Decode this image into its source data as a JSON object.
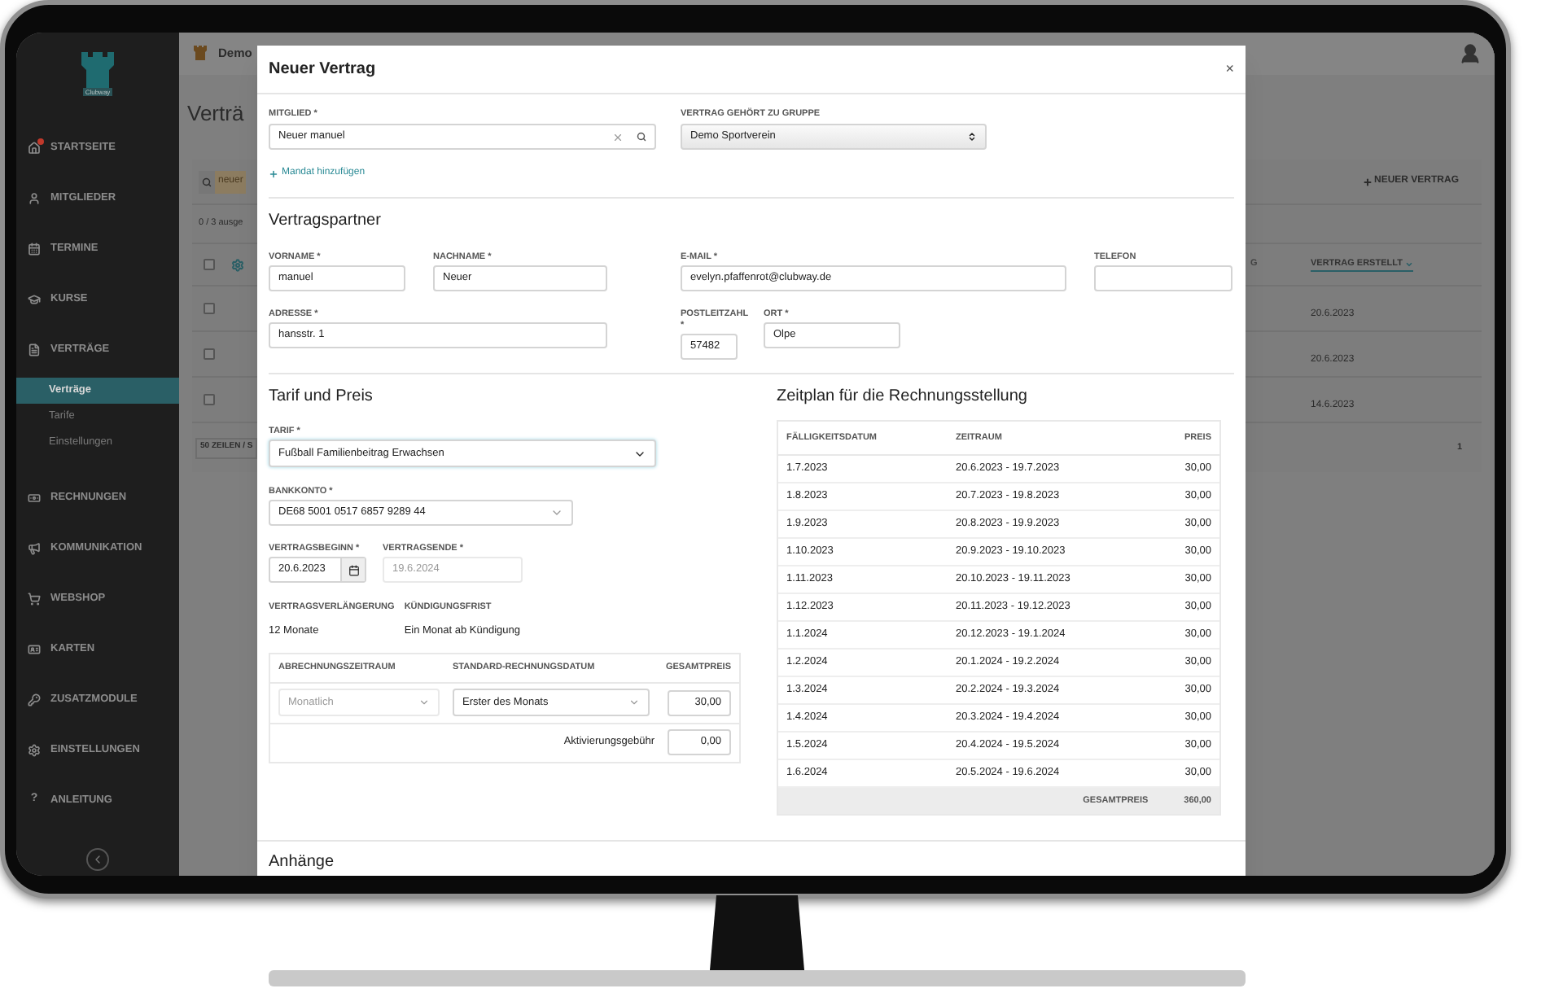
{
  "sidebar": {
    "logo_text": "Clubway",
    "items": [
      {
        "label": "STARTSEITE",
        "selected": false,
        "notification": true
      },
      {
        "label": "MITGLIEDER",
        "selected": false,
        "notification": false
      },
      {
        "label": "TERMINE",
        "selected": false,
        "notification": false
      },
      {
        "label": "KURSE",
        "selected": false,
        "notification": false
      },
      {
        "label": "VERTRÄGE",
        "selected": false,
        "notification": false,
        "children": [
          {
            "label": "Verträge",
            "selected": true
          },
          {
            "label": "Tarife",
            "selected": false
          },
          {
            "label": "Einstellungen",
            "selected": false
          }
        ]
      },
      {
        "label": "RECHNUNGEN",
        "selected": false,
        "notification": false
      },
      {
        "label": "KOMMUNIKATION",
        "selected": false,
        "notification": false
      },
      {
        "label": "WEBSHOP",
        "selected": false,
        "notification": false
      },
      {
        "label": "KARTEN",
        "selected": false,
        "notification": false
      },
      {
        "label": "ZUSATZMODULE",
        "selected": false,
        "notification": false
      },
      {
        "label": "EINSTELLUNGEN",
        "selected": false,
        "notification": false
      },
      {
        "label": "ANLEITUNG",
        "selected": false,
        "notification": false,
        "glyph": "?"
      }
    ]
  },
  "background": {
    "header_title": "Demo",
    "page_title": "Verträ",
    "search_value": "neuer",
    "new_button": "NEUER VERTRAG",
    "selection_count": "0 / 3 ausge",
    "header_checked": false,
    "columns": [
      {
        "label": "G",
        "sorted": false
      },
      {
        "label": "VERTRAG ERSTELLT",
        "sorted": true
      }
    ],
    "rows": [
      {
        "checked": false,
        "created": "20.6.2023"
      },
      {
        "checked": false,
        "created": "20.6.2023"
      },
      {
        "checked": false,
        "created": "14.6.2023"
      }
    ],
    "page_size_button": "50 ZEILEN / S",
    "page": "1"
  },
  "dialog": {
    "title": "Neuer Vertrag",
    "close": "×",
    "member": {
      "label": "MITGLIED *",
      "value": "Neuer manuel"
    },
    "group": {
      "label": "VERTRAG GEHÖRT ZU GRUPPE",
      "value": "Demo Sportverein"
    },
    "add_mandate": "Mandat hinzufügen",
    "partner_heading": "Vertragspartner",
    "partner_fields": [
      {
        "label": "VORNAME *",
        "value": "manuel"
      },
      {
        "label": "NACHNAME *",
        "value": "Neuer"
      },
      {
        "label": "E-MAIL *",
        "value": "evelyn.pfaffenrot@clubway.de"
      },
      {
        "label": "TELEFON"
      },
      {
        "label": "ADRESSE *",
        "value": "hansstr. 1"
      },
      {
        "label": "POSTLEITZAHL *",
        "value": "57482"
      },
      {
        "label": "ORT *",
        "value": "Olpe"
      }
    ],
    "tariff_heading": "Tarif und Preis",
    "tariff": {
      "label": "TARIF *",
      "value": "Fußball Familienbeitrag Erwachsen",
      "focused": true
    },
    "bank": {
      "label": "BANKKONTO *",
      "value": "DE68 5001 0517 6857 9289 44"
    },
    "dates": [
      {
        "label": "VERTRAGSBEGINN *",
        "value": "20.6.2023",
        "disabled": false
      },
      {
        "label": "VERTRAGSENDE *",
        "value": "19.6.2024",
        "disabled": true
      }
    ],
    "terms": [
      {
        "label": "VERTRAGSVERLÄNGERUNG",
        "value": "12 Monate"
      },
      {
        "label": "KÜNDIGUNGSFRIST",
        "value": "Ein Monat ab Kündigung"
      }
    ],
    "billing": {
      "columns": [
        "ABRECHNUNGSZEITRAUM",
        "STANDARD-RECHNUNGSDATUM",
        "GESAMTPREIS"
      ],
      "period": {
        "value": "Monatlich",
        "disabled": true
      },
      "date": {
        "value": "Erster des Monats",
        "disabled": false
      },
      "total": "30,00",
      "fee_label": "Aktivierungsgebühr",
      "fee": "0,00"
    },
    "schedule_heading": "Zeitplan für die Rechnungsstellung",
    "schedule": {
      "columns": [
        "FÄLLIGKEITSDATUM",
        "ZEITRAUM",
        "PREIS"
      ],
      "rows": [
        {
          "due": "1.7.2023",
          "period": "20.6.2023 - 19.7.2023",
          "price": "30,00"
        },
        {
          "due": "1.8.2023",
          "period": "20.7.2023 - 19.8.2023",
          "price": "30,00"
        },
        {
          "due": "1.9.2023",
          "period": "20.8.2023 - 19.9.2023",
          "price": "30,00"
        },
        {
          "due": "1.10.2023",
          "period": "20.9.2023 - 19.10.2023",
          "price": "30,00"
        },
        {
          "due": "1.11.2023",
          "period": "20.10.2023 - 19.11.2023",
          "price": "30,00"
        },
        {
          "due": "1.12.2023",
          "period": "20.11.2023 - 19.12.2023",
          "price": "30,00"
        },
        {
          "due": "1.1.2024",
          "period": "20.12.2023 - 19.1.2024",
          "price": "30,00"
        },
        {
          "due": "1.2.2024",
          "period": "20.1.2024 - 19.2.2024",
          "price": "30,00"
        },
        {
          "due": "1.3.2024",
          "period": "20.2.2024 - 19.3.2024",
          "price": "30,00"
        },
        {
          "due": "1.4.2024",
          "period": "20.3.2024 - 19.4.2024",
          "price": "30,00"
        },
        {
          "due": "1.5.2024",
          "period": "20.4.2024 - 19.5.2024",
          "price": "30,00"
        },
        {
          "due": "1.6.2024",
          "period": "20.5.2024 - 19.6.2024",
          "price": "30,00"
        }
      ],
      "total_label": "GESAMTPREIS",
      "total": "360,00"
    },
    "attachments_heading": "Anhänge"
  }
}
